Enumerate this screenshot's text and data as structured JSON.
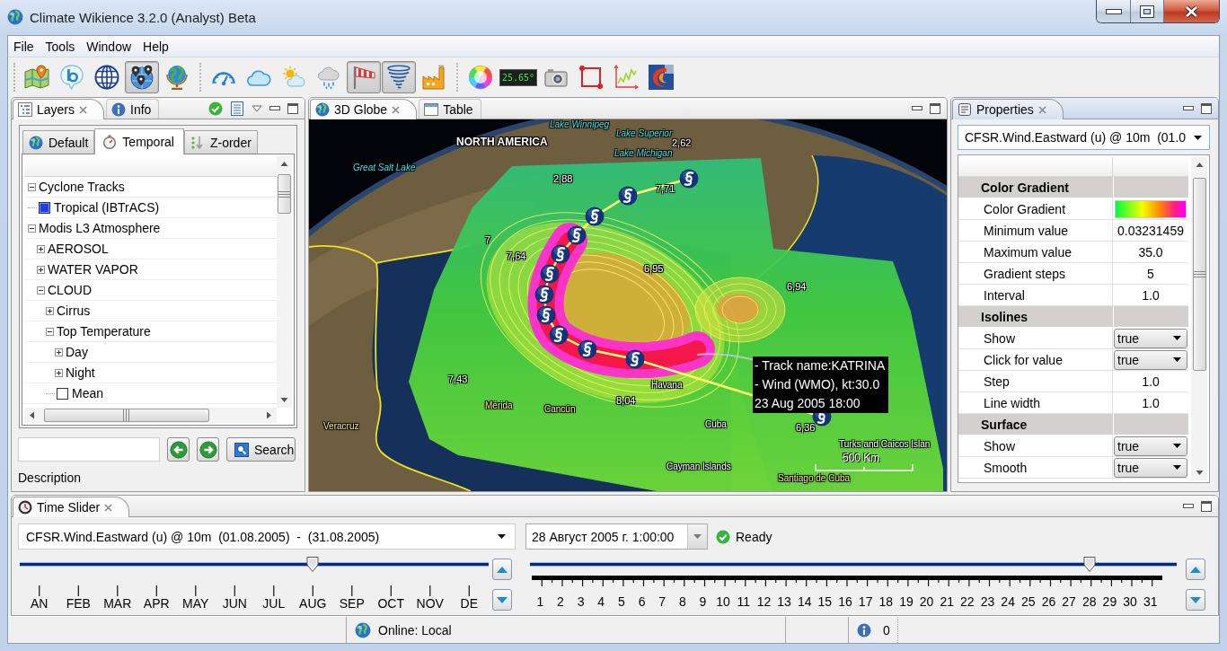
{
  "window": {
    "title": "Climate Wikience 3.2.0 (Analyst) Beta"
  },
  "menu": [
    "File",
    "Tools",
    "Window",
    "Help"
  ],
  "toolbar": [
    {
      "kind": "map",
      "pressed": false
    },
    {
      "kind": "bubble",
      "pressed": false
    },
    {
      "kind": "wireframe",
      "pressed": false
    },
    {
      "kind": "pins",
      "pressed": true
    },
    {
      "kind": "globe",
      "pressed": false
    },
    {
      "kind": "separator"
    },
    {
      "kind": "gauge",
      "pressed": false
    },
    {
      "kind": "cloud",
      "pressed": false
    },
    {
      "kind": "suncloud",
      "pressed": false
    },
    {
      "kind": "rain",
      "pressed": false
    },
    {
      "kind": "windsock",
      "pressed": true
    },
    {
      "kind": "tornado",
      "pressed": true
    },
    {
      "kind": "factory",
      "pressed": false
    },
    {
      "kind": "separator"
    },
    {
      "kind": "palette",
      "pressed": false
    },
    {
      "kind": "display",
      "text": "25.65°",
      "pressed": false
    },
    {
      "kind": "camera",
      "pressed": false
    },
    {
      "kind": "rectangle",
      "pressed": false
    },
    {
      "kind": "chart",
      "pressed": false
    },
    {
      "kind": "logo",
      "pressed": false
    }
  ],
  "layers_view": {
    "focused": false,
    "tabs": [
      {
        "label": "Layers",
        "kind": "layers",
        "selected": true
      },
      {
        "label": "Info",
        "kind": "info",
        "selected": false
      }
    ],
    "subtabs": [
      {
        "label": "Default",
        "kind": "globe",
        "selected": false
      },
      {
        "label": "Temporal",
        "kind": "stopwatch",
        "selected": true
      },
      {
        "label": "Z-order",
        "kind": "order",
        "selected": false
      }
    ],
    "tree": [
      {
        "kind": "group",
        "label": "Cyclone Tracks",
        "expanded": true,
        "children": [
          {
            "kind": "layer",
            "label": "Tropical (IBTrACS)",
            "checked": true
          }
        ]
      },
      {
        "kind": "group",
        "label": "Modis L3 Atmosphere",
        "expanded": true,
        "children": [
          {
            "kind": "group",
            "label": "AEROSOL",
            "expanded": false
          },
          {
            "kind": "group",
            "label": "WATER VAPOR",
            "expanded": false
          },
          {
            "kind": "group",
            "label": "CLOUD",
            "expanded": true,
            "children": [
              {
                "kind": "group",
                "label": "Cirrus",
                "expanded": false
              },
              {
                "kind": "group",
                "label": "Top Temperature",
                "expanded": true,
                "children": [
                  {
                    "kind": "group",
                    "label": "Day",
                    "expanded": false
                  },
                  {
                    "kind": "group",
                    "label": "Night",
                    "expanded": false
                  },
                  {
                    "kind": "layer",
                    "label": "Mean",
                    "checked": false
                  }
                ]
              }
            ]
          }
        ]
      }
    ],
    "search_button": "Search",
    "description": "Description"
  },
  "globe_view": {
    "focused": false,
    "tabs": [
      {
        "label": "3D Globe",
        "kind": "globe",
        "selected": true
      },
      {
        "label": "Table",
        "kind": "table",
        "selected": false
      }
    ],
    "labels": [
      {
        "text": "Lake Winnipeg",
        "kind": "water"
      },
      {
        "text": "NORTH AMERICA",
        "kind": "region"
      },
      {
        "text": "Lake Superior",
        "kind": "water"
      },
      {
        "text": "2,62",
        "kind": "value"
      },
      {
        "text": "Lake Michigan",
        "kind": "water"
      },
      {
        "text": "Great Salt Lake",
        "kind": "water"
      },
      {
        "text": "2,88",
        "kind": "value"
      },
      {
        "text": "7,71",
        "kind": "value"
      },
      {
        "text": "7",
        "kind": "value"
      },
      {
        "text": "7,64",
        "kind": "value"
      },
      {
        "text": "6,95",
        "kind": "value"
      },
      {
        "text": "6,94",
        "kind": "value"
      },
      {
        "text": "7,43",
        "kind": "value"
      },
      {
        "text": "Havana",
        "kind": "place"
      },
      {
        "text": "8,04",
        "kind": "value"
      },
      {
        "text": "Mérida",
        "kind": "city"
      },
      {
        "text": "Cancún",
        "kind": "city"
      },
      {
        "text": "Veracruz",
        "kind": "city"
      },
      {
        "text": "Cuba",
        "kind": "place"
      },
      {
        "text": "6,36",
        "kind": "value"
      },
      {
        "text": "Turks and Caicos Islan",
        "kind": "place"
      },
      {
        "text": "Cayman Islands",
        "kind": "place"
      },
      {
        "text": "Santiago de Cuba",
        "kind": "city"
      }
    ],
    "tooltip": [
      "- Track name:KATRINA",
      "- Wind (WMO), kt:30.0",
      "23 Aug 2005 18:00"
    ],
    "scale": "500 Km"
  },
  "properties_view": {
    "focused": true,
    "tabs": [
      {
        "label": "Properties",
        "kind": "properties",
        "selected": true
      }
    ],
    "layer": "CFSR.Wind.Eastward (u) @ 10m  (01.0",
    "rows": [
      {
        "kind": "section",
        "label": "Color Gradient"
      },
      {
        "kind": "gradient",
        "label": "Color Gradient"
      },
      {
        "kind": "text",
        "label": "Minimum value",
        "value": "0.03231459"
      },
      {
        "kind": "text",
        "label": "Maximum value",
        "value": "35.0"
      },
      {
        "kind": "text",
        "label": "Gradient steps",
        "value": "5"
      },
      {
        "kind": "text",
        "label": "Interval",
        "value": "1.0"
      },
      {
        "kind": "section",
        "label": "Isolines"
      },
      {
        "kind": "choice",
        "label": "Show",
        "value": "true"
      },
      {
        "kind": "choice",
        "label": "Click for value",
        "value": "true"
      },
      {
        "kind": "text",
        "label": "Step",
        "value": "1.0"
      },
      {
        "kind": "text",
        "label": "Line width",
        "value": "1.0"
      },
      {
        "kind": "section",
        "label": "Surface"
      },
      {
        "kind": "choice",
        "label": "Show",
        "value": "true"
      },
      {
        "kind": "choice",
        "label": "Smooth",
        "value": "true"
      }
    ]
  },
  "time_slider_view": {
    "focused": false,
    "tabs": [
      {
        "label": "Time Slider",
        "kind": "clock",
        "selected": true
      }
    ],
    "layer": "CFSR.Wind.Eastward (u) @ 10m  (01.08.2005)  -  (31.08.2005)",
    "date": "28 Август 2005 г. 1:00:00",
    "status": "Ready",
    "months": {
      "labels": [
        "AN",
        "FEB",
        "MAR",
        "APR",
        "MAY",
        "JUN",
        "JUL",
        "AUG",
        "SEP",
        "OCT",
        "NOV",
        "DE"
      ],
      "level": 0.636
    },
    "days": {
      "labels": [
        "1",
        "2",
        "3",
        "4",
        "5",
        "6",
        "7",
        "8",
        "9",
        "10",
        "11",
        "12",
        "13",
        "14",
        "15",
        "16",
        "17",
        "18",
        "19",
        "20",
        "21",
        "22",
        "23",
        "24",
        "25",
        "26",
        "27",
        "28",
        "29",
        "30",
        "31"
      ],
      "level": 0.9
    }
  },
  "status_bar": {
    "connection": "Online: Local",
    "messages": "0"
  }
}
